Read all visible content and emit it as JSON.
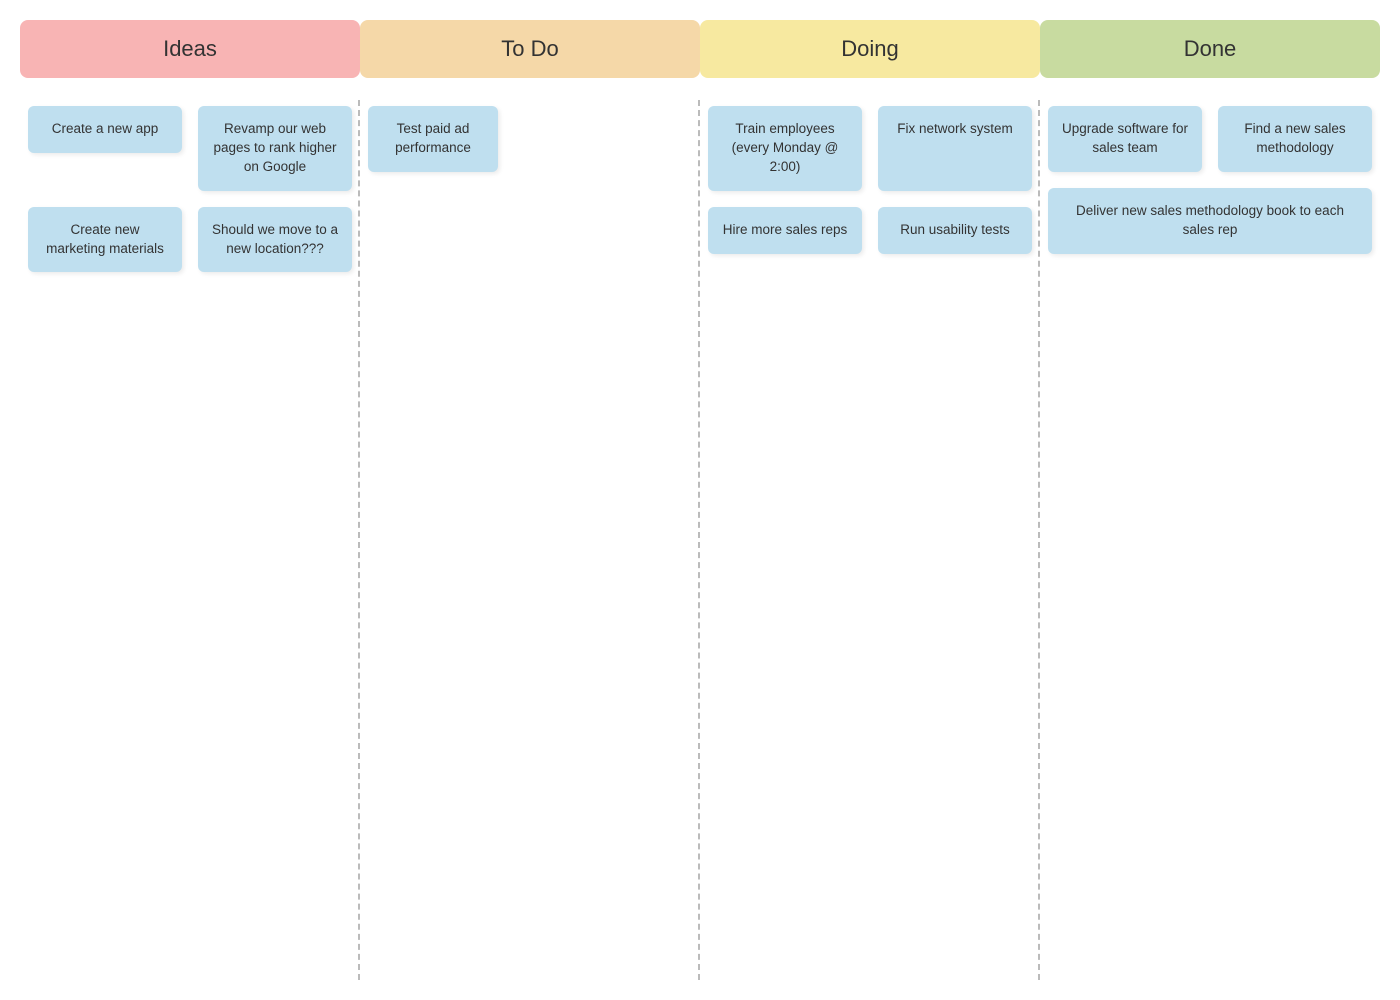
{
  "columns": [
    {
      "id": "ideas",
      "label": "Ideas",
      "headerColor": "#f8b4b4",
      "cards": [
        {
          "id": "ideas-1",
          "text": "Create a new app"
        },
        {
          "id": "ideas-2",
          "text": "Revamp our web pages to rank higher on Google"
        },
        {
          "id": "ideas-3",
          "text": "Create new marketing materials"
        },
        {
          "id": "ideas-4",
          "text": "Should we move to a new location???"
        }
      ]
    },
    {
      "id": "todo",
      "label": "To Do",
      "headerColor": "#f5d8a8",
      "cards": [
        {
          "id": "todo-1",
          "text": "Test paid ad performance"
        }
      ]
    },
    {
      "id": "doing",
      "label": "Doing",
      "headerColor": "#f7e9a0",
      "cards": [
        {
          "id": "doing-1",
          "text": "Train employees (every Monday @ 2:00)"
        },
        {
          "id": "doing-2",
          "text": "Fix network system"
        },
        {
          "id": "doing-3",
          "text": "Hire more sales reps"
        },
        {
          "id": "doing-4",
          "text": "Run usability tests"
        }
      ]
    },
    {
      "id": "done",
      "label": "Done",
      "headerColor": "#c8dba0",
      "cards": [
        {
          "id": "done-1",
          "text": "Upgrade software for sales team"
        },
        {
          "id": "done-2",
          "text": "Find a new sales methodology"
        },
        {
          "id": "done-3",
          "text": "Deliver new sales methodology book to each sales rep"
        }
      ]
    }
  ]
}
